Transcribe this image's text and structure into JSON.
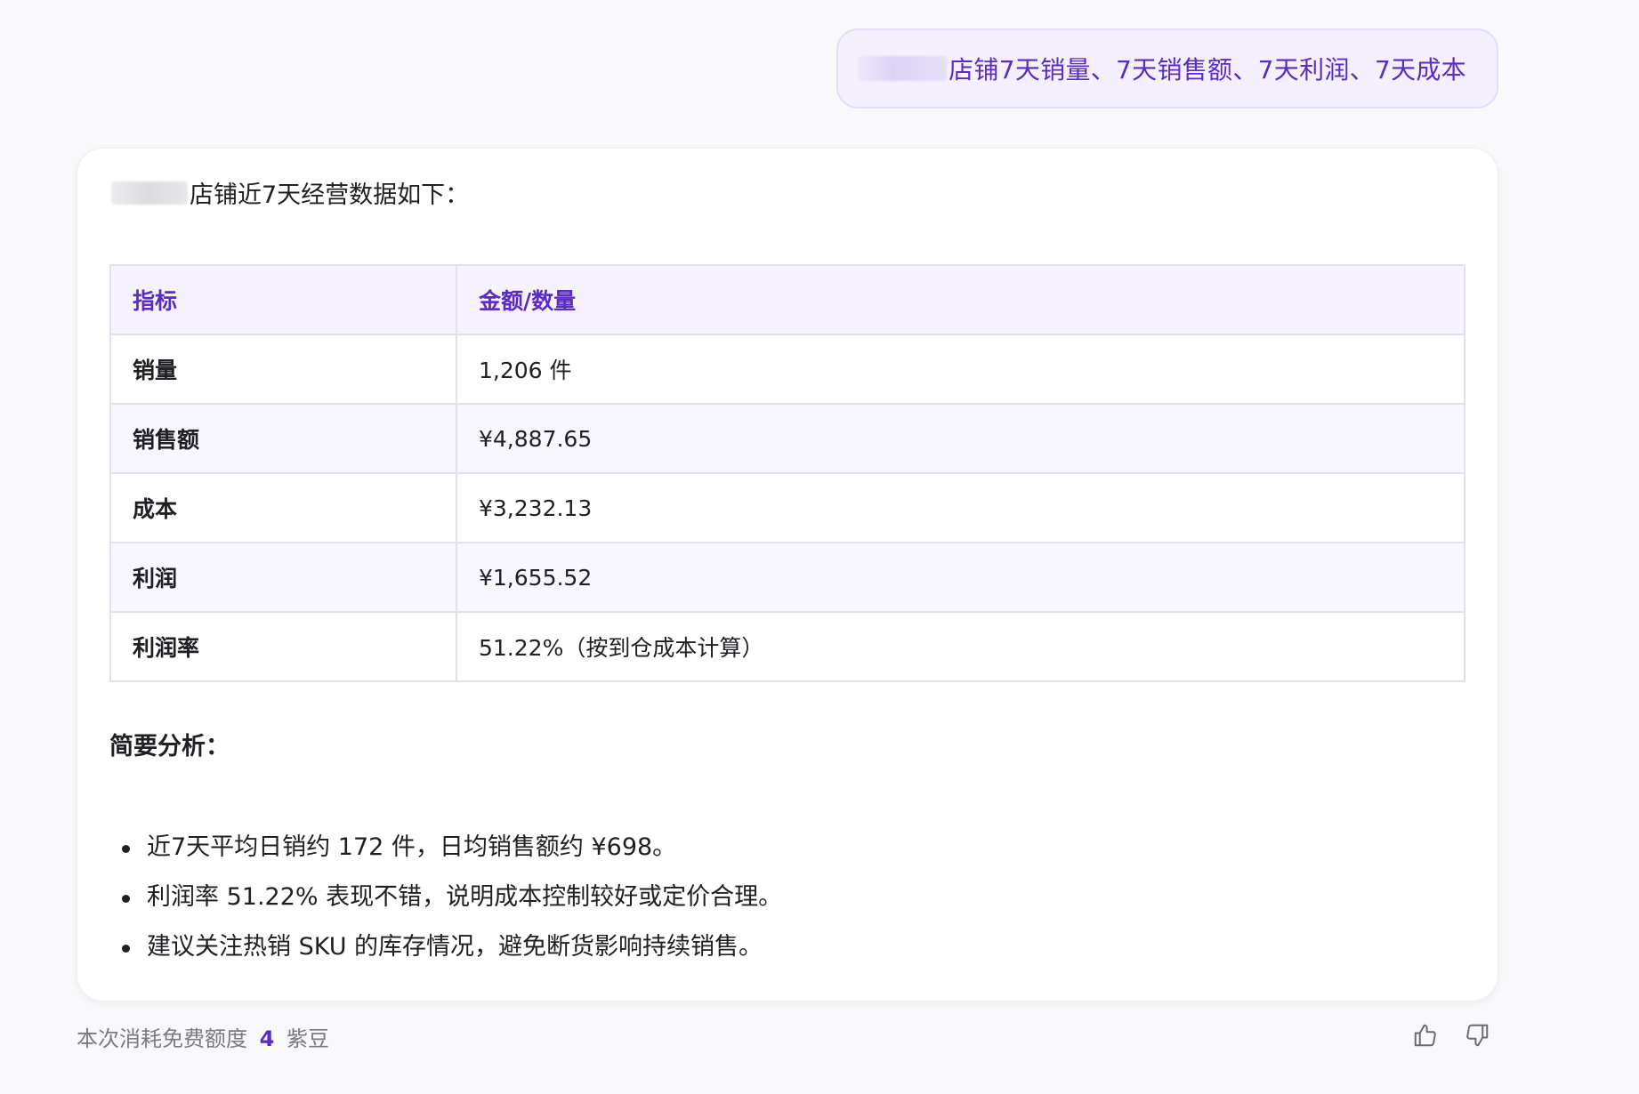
{
  "user_message": {
    "text": "店铺7天销量、7天销售额、7天利润、7天成本"
  },
  "assistant": {
    "intro": "店铺近7天经营数据如下：",
    "table": {
      "headers": [
        "指标",
        "金额/数量"
      ],
      "rows": [
        {
          "metric": "销量",
          "value": "1,206 件"
        },
        {
          "metric": "销售额",
          "value": "¥4,887.65"
        },
        {
          "metric": "成本",
          "value": "¥3,232.13"
        },
        {
          "metric": "利润",
          "value": "¥1,655.52"
        },
        {
          "metric": "利润率",
          "value": "51.22%（按到仓成本计算）"
        }
      ]
    },
    "analysis_title": "简要分析：",
    "analysis_points": [
      "近7天平均日销约 172 件，日均销售额约 ¥698。",
      "利润率 51.22% 表现不错，说明成本控制较好或定价合理。",
      "建议关注热销 SKU 的库存情况，避免断货影响持续销售。"
    ]
  },
  "footer": {
    "prefix": "本次消耗免费额度",
    "count": "4",
    "unit": "紫豆"
  },
  "icons": {
    "like": "thumbs-up-icon",
    "dislike": "thumbs-down-icon"
  },
  "colors": {
    "accent": "#5b2bc4",
    "bubble_bg": "#f4f0fe",
    "header_bg": "#f6f3fe",
    "page_bg": "#f9f9fb"
  }
}
